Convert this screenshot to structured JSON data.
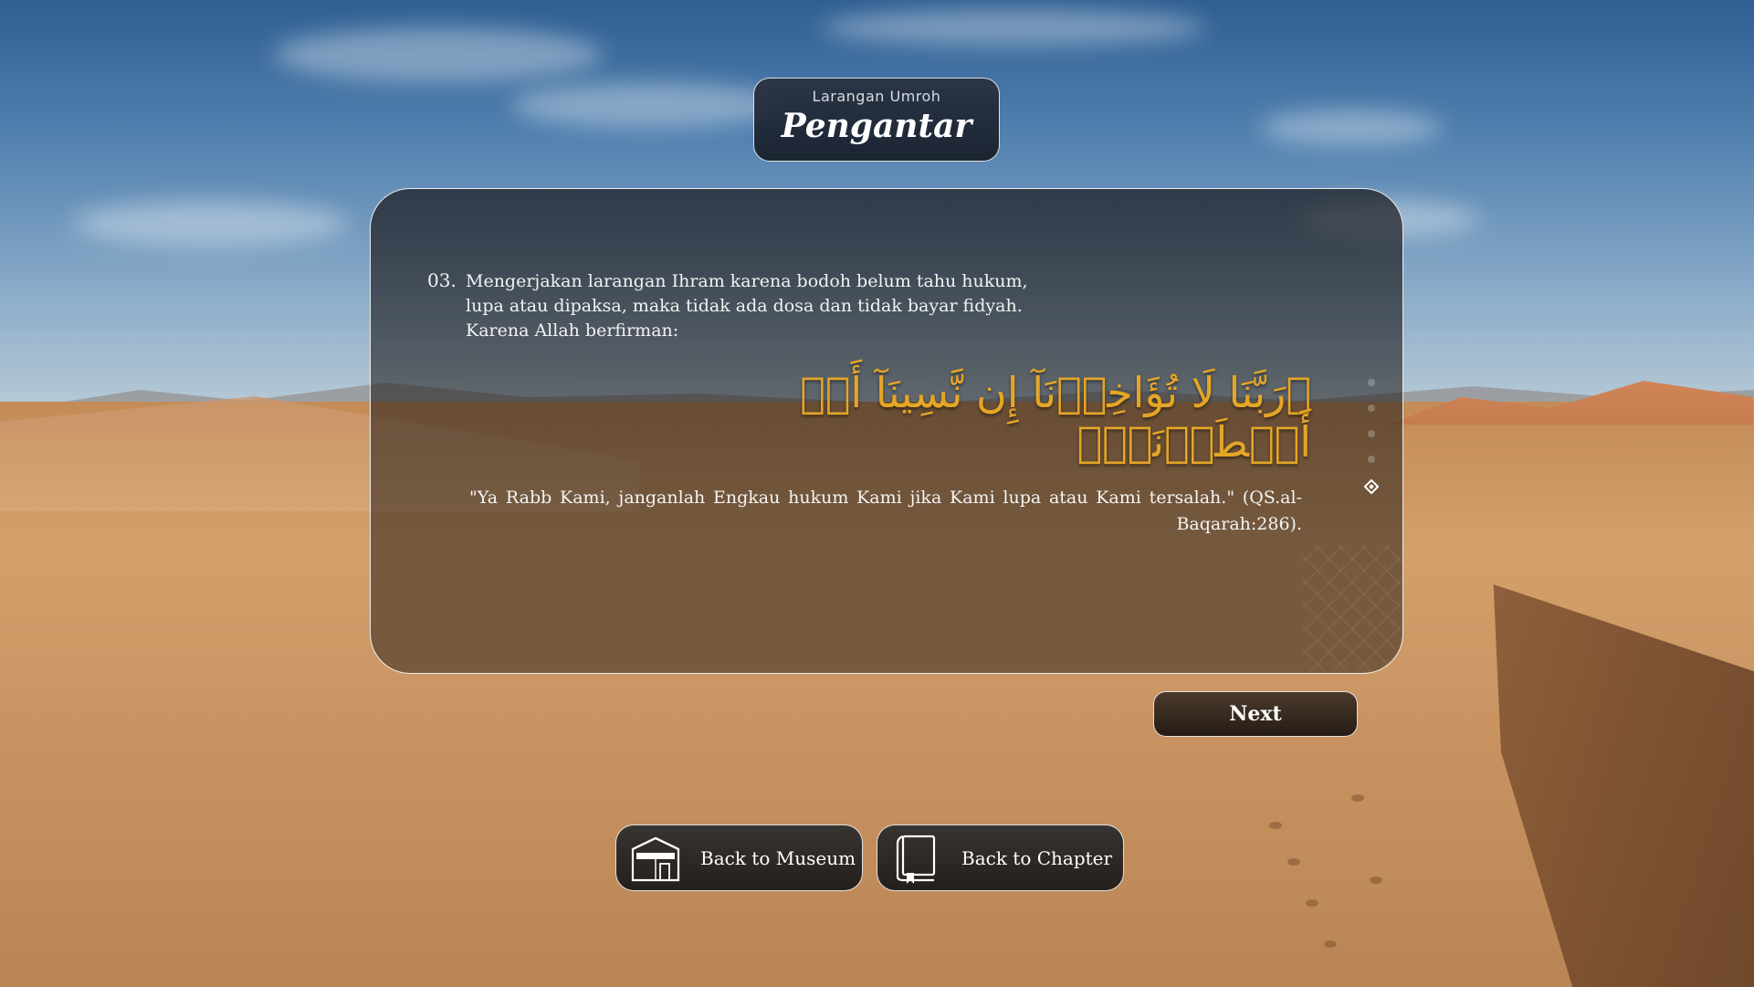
{
  "header": {
    "subtitle": "Larangan Umroh",
    "title": "Pengantar"
  },
  "content": {
    "item_number": "03.",
    "item_text": "Mengerjakan larangan Ihram karena bodoh belum tahu hukum, lupa atau dipaksa, maka tidak ada dosa dan tidak bayar fidyah. Karena Allah berfirman:",
    "arabic_verse": "﴿رَبَّنَا لَا تُؤَاخِذۡنَآ إِن نَّسِينَآ أَوۡ أَخۡطَأۡنَاۚ﴾",
    "translation": "\"Ya Rabb Kami, janganlah Engkau hukum Kami jika Kami lupa atau Kami tersalah.\" (QS.al-Baqarah:286)."
  },
  "pagination": {
    "total": 5,
    "active_index": 4
  },
  "buttons": {
    "next": "Next",
    "back_museum": "Back to Museum",
    "back_chapter": "Back to Chapter"
  },
  "colors": {
    "arabic_gold": "#e5a626",
    "panel_dark": "#1c1c20"
  },
  "icons": {
    "museum": "kaaba-icon",
    "chapter": "book-icon"
  }
}
